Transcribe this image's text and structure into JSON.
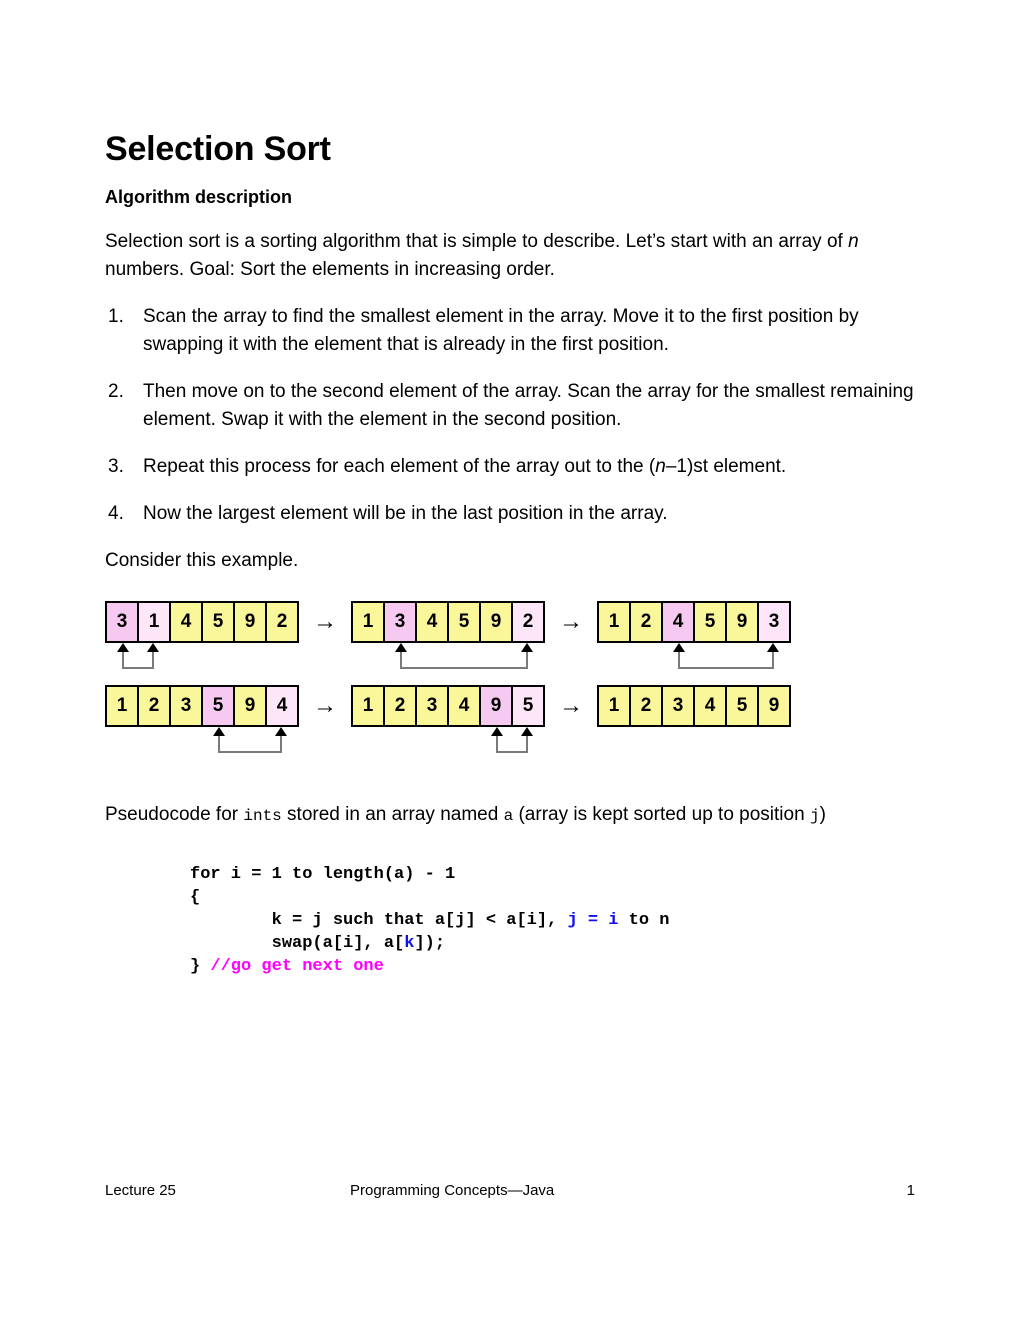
{
  "document": {
    "title": "Selection Sort",
    "subtitle": "Algorithm description",
    "intro_before_n": "Selection sort is a sorting algorithm that is simple to describe.  Let’s start with an array of ",
    "intro_n": "n",
    "intro_after_n": " numbers.  Goal:  Sort the elements in increasing order.",
    "steps": [
      {
        "number": "1.",
        "text": "Scan the array to find the smallest element in the array.  Move it to the first position by swapping it with the element that is already in the first position."
      },
      {
        "number": "2.",
        "text": "Then move on to the second element of the array.  Scan the array for the smallest remaining element. Swap it with the element in the second position."
      },
      {
        "number": "3.",
        "text_before_n": "Repeat this process for each element of the array out to the (",
        "text_n": "n",
        "text_after_n": "–1)st element."
      },
      {
        "number": "4.",
        "text": "Now the largest element will be in the last position in the array."
      }
    ],
    "example_lead": "Consider this example.",
    "separator_arrow": "→"
  },
  "diagram": {
    "rows": [
      {
        "arrays": [
          {
            "values": [
              "3",
              "1",
              "4",
              "5",
              "9",
              "2"
            ],
            "colors": [
              "pink",
              "lightpink",
              "yellow",
              "yellow",
              "yellow",
              "yellow"
            ],
            "swap_from": 0,
            "swap_to": 1
          },
          {
            "values": [
              "1",
              "3",
              "4",
              "5",
              "9",
              "2"
            ],
            "colors": [
              "yellow",
              "pink",
              "yellow",
              "yellow",
              "yellow",
              "lightpink"
            ],
            "swap_from": 1,
            "swap_to": 5
          },
          {
            "values": [
              "1",
              "2",
              "4",
              "5",
              "9",
              "3"
            ],
            "colors": [
              "yellow",
              "yellow",
              "pink",
              "yellow",
              "yellow",
              "lightpink"
            ],
            "swap_from": 2,
            "swap_to": 5
          }
        ]
      },
      {
        "arrays": [
          {
            "values": [
              "1",
              "2",
              "3",
              "5",
              "9",
              "4"
            ],
            "colors": [
              "yellow",
              "yellow",
              "yellow",
              "pink",
              "yellow",
              "lightpink"
            ],
            "swap_from": 3,
            "swap_to": 5
          },
          {
            "values": [
              "1",
              "2",
              "3",
              "4",
              "9",
              "5"
            ],
            "colors": [
              "yellow",
              "yellow",
              "yellow",
              "yellow",
              "pink",
              "lightpink"
            ],
            "swap_from": 4,
            "swap_to": 5
          },
          {
            "values": [
              "1",
              "2",
              "3",
              "4",
              "5",
              "9"
            ],
            "colors": [
              "yellow",
              "yellow",
              "yellow",
              "yellow",
              "yellow",
              "yellow"
            ],
            "swap_from": null,
            "swap_to": null
          }
        ]
      }
    ],
    "colors": {
      "yellow": "#FAF79B",
      "pink": "#F6C9F1",
      "lightpink": "#FCE6F8",
      "border": "#000000",
      "connector": "#7a7a7a"
    }
  },
  "pseudocode": {
    "intro_part1": "Pseudocode for ",
    "intro_ints": "ints",
    "intro_part2": " stored in an array named ",
    "intro_a": "a",
    "intro_part3": " (array is kept sorted up to position ",
    "intro_j": "j",
    "intro_part4": ")",
    "lines": {
      "l1": "for i = 1 to length(a) - 1",
      "l2": "{",
      "l3_black1": "        k = j such that a[j] < a[i], ",
      "l3_blue": "j = i",
      "l3_black2": " to n",
      "l4_black1": "        swap(a[i], a[",
      "l4_blue": "k",
      "l4_black2": "]);",
      "l5_black": "} ",
      "l5_magenta": "//go get next one"
    },
    "token_colors": {
      "blue": "#1111EE",
      "magenta": "#FF00FF"
    }
  },
  "footer": {
    "left": "Lecture 25",
    "center": "Programming Concepts—Java",
    "right": "1"
  }
}
